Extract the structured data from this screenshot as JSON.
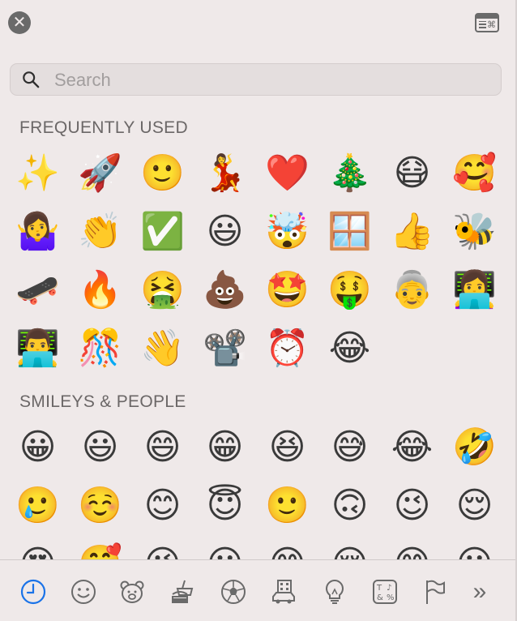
{
  "window": {
    "close_icon": "close-icon",
    "viewer_icon": "character-viewer-icon",
    "close_glyph": "✕"
  },
  "search": {
    "placeholder": "Search"
  },
  "sections": {
    "frequent": {
      "title": "FREQUENTLY USED",
      "emojis": [
        "✨",
        "🚀",
        "🙂",
        "💃",
        "❤️",
        "🎄",
        "😷",
        "🥰",
        "🤷‍♀️",
        "👏",
        "✅",
        "😃",
        "🤯",
        "🪟",
        "👍",
        "🐝",
        "🛹",
        "🔥",
        "🤮",
        "💩",
        "🤩",
        "🤑",
        "👵",
        "👩‍💻",
        "👨‍💻",
        "🎊",
        "👋",
        "📽️",
        "⏰",
        "😂"
      ]
    },
    "smileys": {
      "title": "SMILEYS & PEOPLE",
      "emojis": [
        "😀",
        "😃",
        "😄",
        "😁",
        "😆",
        "😅",
        "😂",
        "🤣",
        "🥲",
        "☺️",
        "😊",
        "😇",
        "🙂",
        "🙃",
        "😉",
        "😌",
        "😍",
        "🥰",
        "😘",
        "😗",
        "😙",
        "😚",
        "😋",
        "😛"
      ]
    }
  },
  "categories": [
    {
      "name": "frequently-used",
      "icon": "clock-icon",
      "active": true
    },
    {
      "name": "smileys-people",
      "icon": "smiley-icon"
    },
    {
      "name": "animals-nature",
      "icon": "bear-icon"
    },
    {
      "name": "food-drink",
      "icon": "food-icon"
    },
    {
      "name": "activity",
      "icon": "soccer-ball-icon"
    },
    {
      "name": "travel-places",
      "icon": "building-car-icon"
    },
    {
      "name": "objects",
      "icon": "lightbulb-icon"
    },
    {
      "name": "symbols",
      "icon": "symbols-icon"
    },
    {
      "name": "flags",
      "icon": "flag-icon"
    },
    {
      "name": "more",
      "icon": "double-chevron-icon",
      "glyph": "»"
    }
  ],
  "colors": {
    "accent": "#1a73e8",
    "icon": "#6a6a6a",
    "background": "#efe9e9"
  }
}
